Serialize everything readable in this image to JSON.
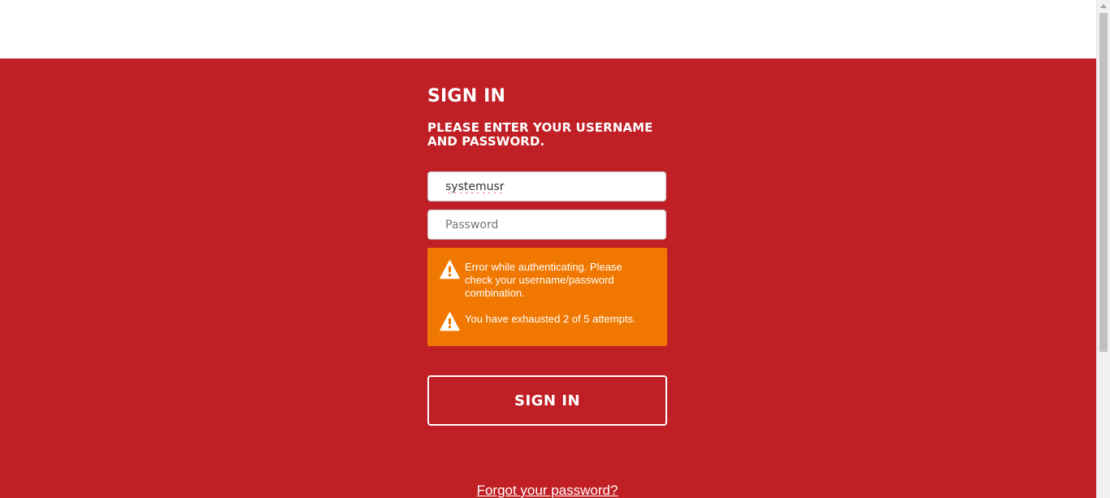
{
  "signin": {
    "title": "SIGN IN",
    "subtitle": "PLEASE ENTER YOUR USERNAME AND PASSWORD.",
    "username_value": "systemusr",
    "password_placeholder": "Password",
    "errors": [
      {
        "icon": "warning-icon",
        "text": "Error while authenticating. Please check your username/password combination."
      },
      {
        "icon": "warning-icon",
        "text": "You have exhausted 2 of 5 attempts."
      }
    ],
    "button_label": "SIGN IN",
    "forgot_link": "Forgot your password?"
  },
  "colors": {
    "background": "#c01f25",
    "error_background": "#f07800",
    "text": "#ffffff"
  }
}
